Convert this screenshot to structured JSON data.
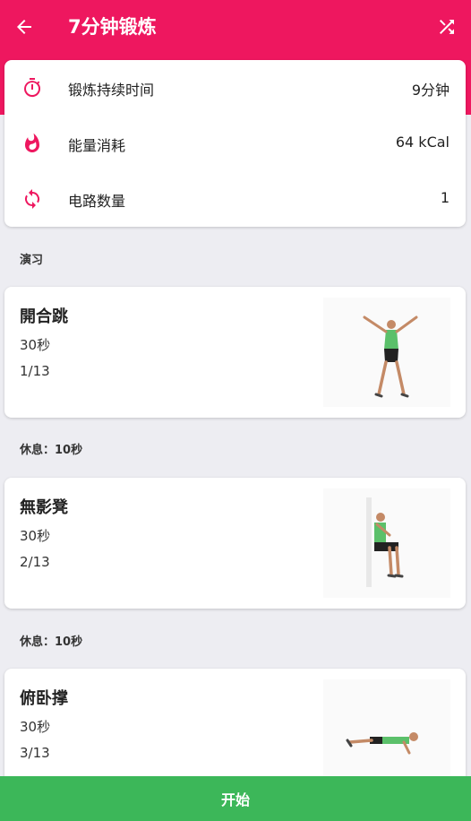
{
  "header": {
    "title": "7分钟锻炼",
    "back_icon": "arrow-left-icon",
    "shuffle_icon": "shuffle-icon",
    "color": "#ee175f"
  },
  "summary": [
    {
      "icon": "stopwatch-icon",
      "label": "锻炼持续时间",
      "value": "9分钟"
    },
    {
      "icon": "flame-icon",
      "label": "能量消耗",
      "value": "64 kCal"
    },
    {
      "icon": "repeat-icon",
      "label": "电路数量",
      "value": "1"
    }
  ],
  "section_title": "演习",
  "exercises": [
    {
      "name": "開合跳",
      "duration": "30秒",
      "index": "1/13",
      "image": "jumping-jacks-illustration"
    },
    {
      "name": "無影凳",
      "duration": "30秒",
      "index": "2/13",
      "image": "wall-sit-illustration"
    },
    {
      "name": "俯卧撑",
      "duration": "30秒",
      "index": "3/13",
      "image": "push-up-illustration"
    }
  ],
  "rests": [
    {
      "label": "休息：",
      "value": "10秒"
    },
    {
      "label": "休息：",
      "value": "10秒"
    }
  ],
  "start_button": {
    "label": "开始",
    "color": "#3cb759"
  }
}
